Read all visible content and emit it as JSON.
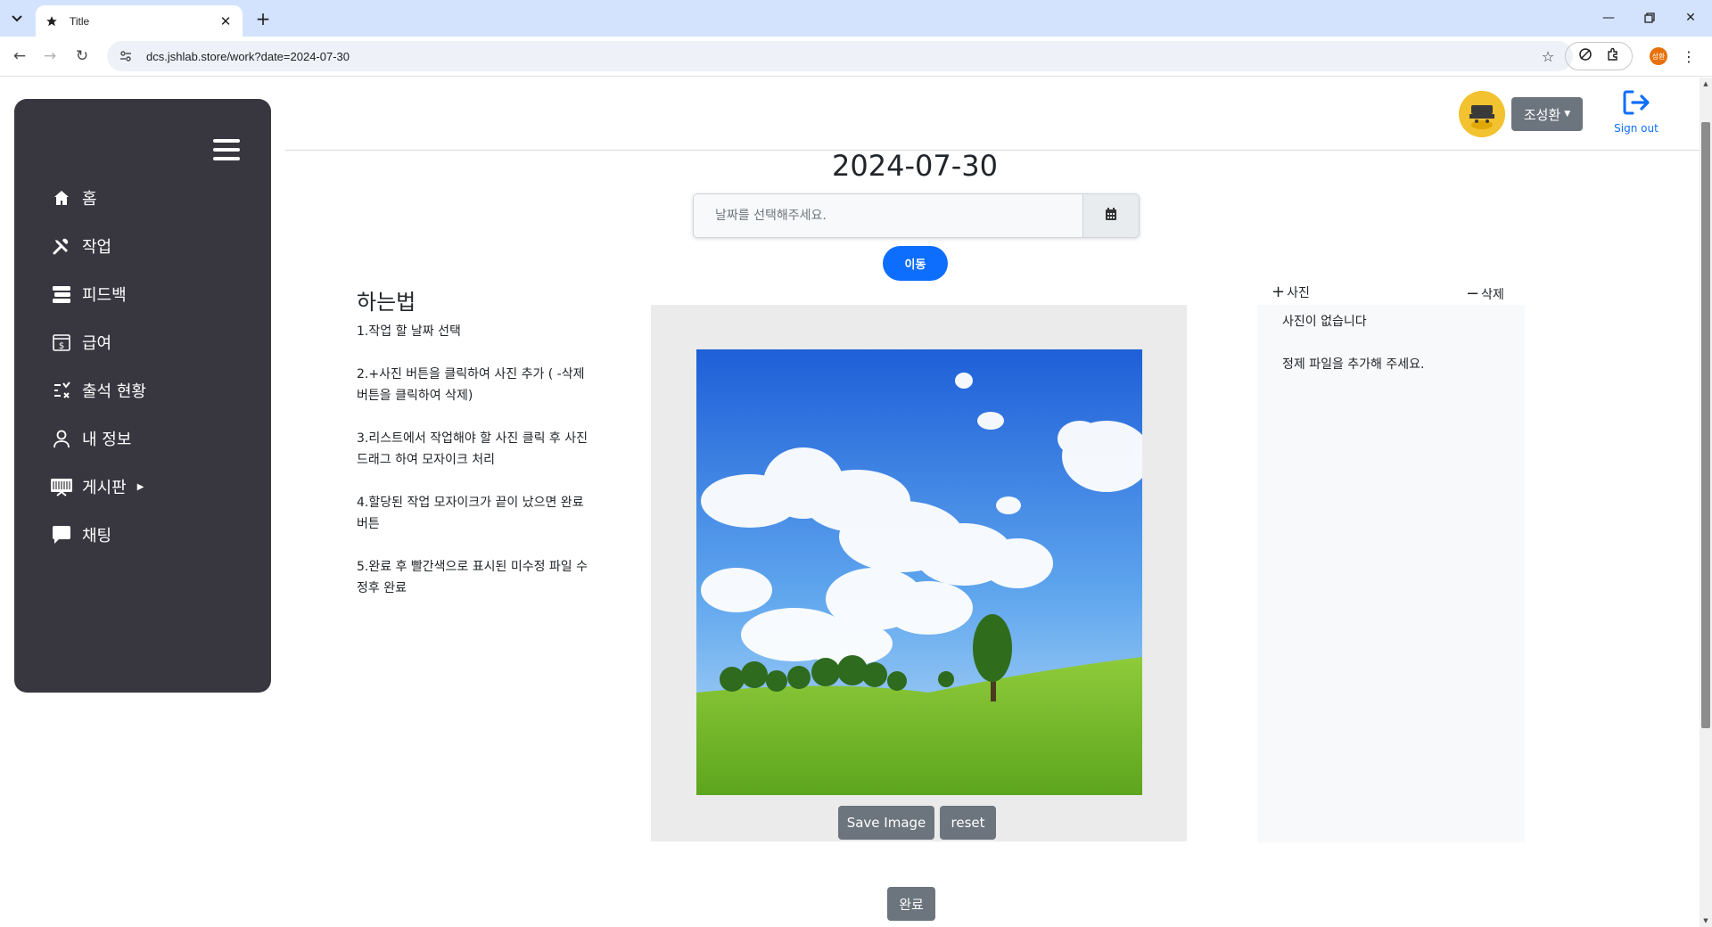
{
  "browser": {
    "tab_title": "Title",
    "url": "dcs.jshlab.store/work?date=2024-07-30",
    "profile_initials": "성환"
  },
  "sidebar": {
    "items": [
      {
        "label": "홈",
        "icon": "home-icon"
      },
      {
        "label": "작업",
        "icon": "tools-icon"
      },
      {
        "label": "피드백",
        "icon": "stack-icon"
      },
      {
        "label": "급여",
        "icon": "receipt-dollar-icon"
      },
      {
        "label": "출석 현황",
        "icon": "checklist-icon"
      },
      {
        "label": "내 정보",
        "icon": "person-icon"
      },
      {
        "label": "게시판",
        "icon": "board-icon"
      },
      {
        "label": "채팅",
        "icon": "chat-icon"
      }
    ]
  },
  "header": {
    "user_name": "조성환",
    "signout_label": "Sign out"
  },
  "date_picker": {
    "title": "2024-07-30",
    "placeholder": "날짜를 선택해주세요.",
    "go_label": "이동"
  },
  "howto": {
    "title": "하는법",
    "steps": [
      "1.작업 할 날짜 선택",
      "2.+사진 버튼을 클릭하여 사진 추가 ( -삭제 버튼을 클릭하여 삭제)",
      "3.리스트에서 작업해야 할 사진 클릭 후 사진 드래그 하여 모자이크 처리",
      "4.할당된 작업 모자이크가 끝이 났으면 완료 버튼",
      "5.완료 후 빨간색으로 표시된 미수정 파일 수정후 완료"
    ]
  },
  "editor": {
    "save_label": "Save Image",
    "reset_label": "reset"
  },
  "photos": {
    "add_label": "사진",
    "delete_label": "삭제",
    "empty_message": "사진이 없습니다",
    "hint_message": "정제 파일을 추가해 주세요."
  },
  "done_label": "완료",
  "colors": {
    "sidebar_bg": "#383740",
    "primary": "#0d6efd",
    "secondary": "#6c757d",
    "tab_strip": "#d3e3fd"
  }
}
